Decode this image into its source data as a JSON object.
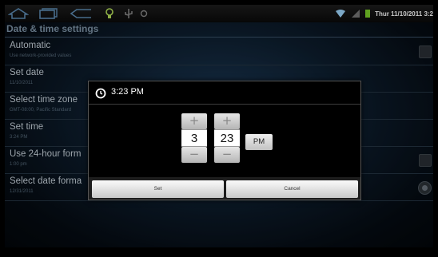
{
  "status_bar": {
    "datetime": "Thur 11/10/2011 3:2"
  },
  "screen_title": "Date & time settings",
  "settings": [
    {
      "label": "Automatic",
      "summary": "Use network-provided values"
    },
    {
      "label": "Set date",
      "summary": "11/10/2011"
    },
    {
      "label": "Select time zone",
      "summary": "GMT-08:00, Pacific Standard"
    },
    {
      "label": "Set time",
      "summary": "3:24 PM"
    },
    {
      "label": "Use 24-hour form",
      "summary": "1:00 pm"
    },
    {
      "label": "Select date forma",
      "summary": "12/31/2011"
    }
  ],
  "dialog": {
    "title": "3:23 PM",
    "hour": "3",
    "minute": "23",
    "ampm": "PM",
    "increment_symbol": "+",
    "decrement_symbol": "−",
    "set_label": "Set",
    "cancel_label": "Cancel"
  },
  "icons": {
    "home": "home-icon",
    "recent_apps": "recent-apps-icon",
    "back": "back-icon",
    "bulb": "lightbulb-icon",
    "usb": "usb-icon",
    "notification_dot": "notification-icon",
    "wifi": "wifi-icon",
    "signal": "signal-icon",
    "battery": "battery-icon",
    "clock": "clock-icon"
  },
  "colors": {
    "accent_battery": "#7ccf2a",
    "wifi": "#9fd8ff"
  }
}
